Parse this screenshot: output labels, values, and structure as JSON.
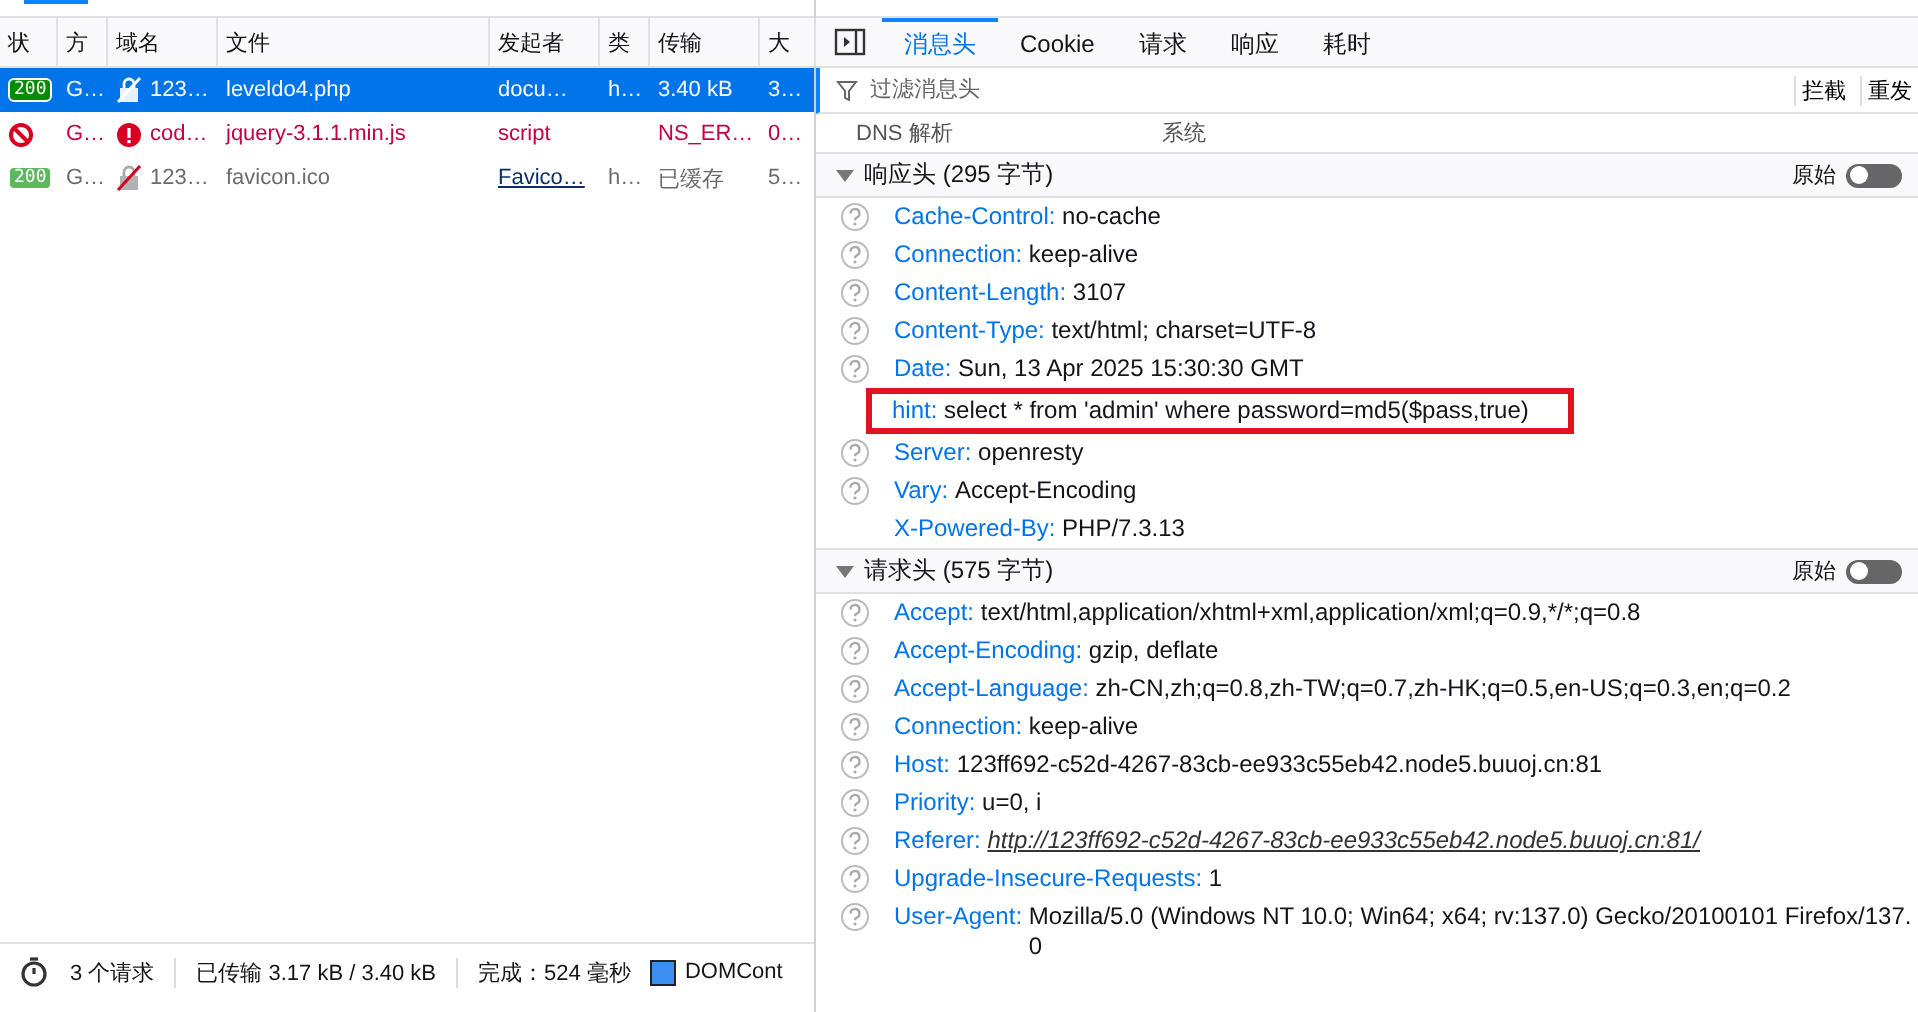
{
  "requests": {
    "columns": [
      "状",
      "方",
      "域名",
      "文件",
      "发起者",
      "类",
      "传输",
      "大"
    ],
    "rows": [
      {
        "status": "200",
        "method": "G…",
        "domain": "123…",
        "file": "leveldo4.php",
        "initiator": "docu…",
        "initiator_link": false,
        "type": "h…",
        "transferred": "3.40 kB",
        "size": "3…",
        "selected": true,
        "error": false,
        "cached": false
      },
      {
        "method": "G…",
        "domain": "cod…",
        "file": "jquery-3.1.1.min.js",
        "initiator": "script",
        "initiator_link": false,
        "transferred": "NS_ER…",
        "size": "0…",
        "selected": false,
        "error": true,
        "cached": false
      },
      {
        "status": "200",
        "method": "G…",
        "domain": "123…",
        "file": "favicon.ico",
        "initiator": "Favico…",
        "initiator_link": true,
        "type": "h…",
        "transferred": "已缓存",
        "size": "5…",
        "selected": false,
        "error": false,
        "cached": true
      }
    ]
  },
  "status_bar": {
    "requests": "3 个请求",
    "transferred": "已传输 3.17 kB / 3.40 kB",
    "finish": "完成：524 毫秒",
    "dom": "DOMCont"
  },
  "details": {
    "tabs": [
      {
        "label": "消息头",
        "selected": true
      },
      {
        "label": "Cookie",
        "selected": false
      },
      {
        "label": "请求",
        "selected": false
      },
      {
        "label": "响应",
        "selected": false
      },
      {
        "label": "耗时",
        "selected": false
      }
    ],
    "filter": {
      "placeholder": "过滤消息头"
    },
    "actions": [
      "拦截",
      "重发"
    ],
    "summary": [
      {
        "name": "DNS 解析",
        "value": "系统"
      }
    ],
    "sections": [
      {
        "title": "响应头 (295 字节)",
        "expanded": true,
        "raw_label": "原始",
        "raw_on": false,
        "headers": [
          {
            "name": "Cache-Control:",
            "value": "no-cache",
            "help": true,
            "highlighted": false
          },
          {
            "name": "Connection:",
            "value": "keep-alive",
            "help": true,
            "highlighted": false
          },
          {
            "name": "Content-Length:",
            "value": "3107",
            "help": true,
            "highlighted": false
          },
          {
            "name": "Content-Type:",
            "value": "text/html; charset=UTF-8",
            "help": true,
            "highlighted": false
          },
          {
            "name": "Date:",
            "value": "Sun, 13 Apr 2025 15:30:30 GMT",
            "help": true,
            "highlighted": false
          },
          {
            "name": "hint:",
            "value": "select * from 'admin' where password=md5($pass,true)",
            "help": false,
            "highlighted": true
          },
          {
            "name": "Server:",
            "value": "openresty",
            "help": true,
            "highlighted": false
          },
          {
            "name": "Vary:",
            "value": "Accept-Encoding",
            "help": true,
            "highlighted": false
          },
          {
            "name": "X-Powered-By:",
            "value": "PHP/7.3.13",
            "help": false,
            "highlighted": false
          }
        ]
      },
      {
        "title": "请求头 (575 字节)",
        "expanded": true,
        "raw_label": "原始",
        "raw_on": false,
        "headers": [
          {
            "name": "Accept:",
            "value": "text/html,application/xhtml+xml,application/xml;q=0.9,*/*;q=0.8",
            "help": true,
            "highlighted": false
          },
          {
            "name": "Accept-Encoding:",
            "value": "gzip, deflate",
            "help": true,
            "highlighted": false
          },
          {
            "name": "Accept-Language:",
            "value": "zh-CN,zh;q=0.8,zh-TW;q=0.7,zh-HK;q=0.5,en-US;q=0.3,en;q=0.2",
            "help": true,
            "highlighted": false
          },
          {
            "name": "Connection:",
            "value": "keep-alive",
            "help": true,
            "highlighted": false
          },
          {
            "name": "Host:",
            "value": "123ff692-c52d-4267-83cb-ee933c55eb42.node5.buuoj.cn:81",
            "help": true,
            "highlighted": false
          },
          {
            "name": "Priority:",
            "value": "u=0, i",
            "help": true,
            "highlighted": false
          },
          {
            "name": "Referer:",
            "value": "http://123ff692-c52d-4267-83cb-ee933c55eb42.node5.buuoj.cn:81/",
            "help": true,
            "highlighted": false,
            "link": true
          },
          {
            "name": "Upgrade-Insecure-Requests:",
            "value": "1",
            "help": true,
            "highlighted": false
          },
          {
            "name": "User-Agent:",
            "value": "Mozilla/5.0 (Windows NT 10.0; Win64; x64; rv:137.0) Gecko/20100101 Firefox/137.0",
            "help": true,
            "highlighted": false
          }
        ]
      }
    ]
  }
}
